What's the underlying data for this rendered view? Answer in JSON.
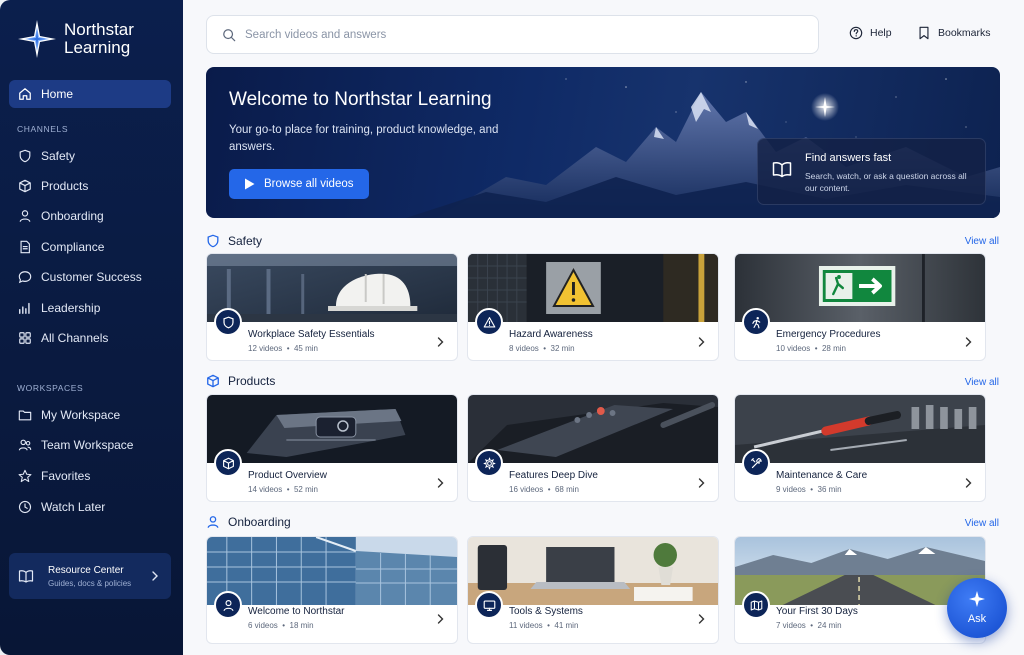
{
  "brand": {
    "line1": "Northstar",
    "line2": "Learning"
  },
  "nav": {
    "home": "Home",
    "channels_label": "CHANNELS",
    "channels": [
      "Safety",
      "Products",
      "Onboarding",
      "Compliance",
      "Customer Success",
      "Leadership",
      "All Channels"
    ],
    "workspaces_label": "WORKSPACES",
    "workspaces": [
      "My Workspace",
      "Team Workspace",
      "Favorites",
      "Watch Later"
    ]
  },
  "resource": {
    "title": "Resource Center",
    "subtitle": "Guides, docs & policies"
  },
  "search": {
    "placeholder": "Search videos and answers"
  },
  "toplinks": {
    "help": "Help",
    "bookmarks": "Bookmarks"
  },
  "hero": {
    "title": "Welcome to Northstar Learning",
    "subtitle": "Your go-to place for training, product knowledge, and answers.",
    "button": "Browse all videos",
    "find_title": "Find answers fast",
    "find_sub": "Search, watch, or ask a question across all our content."
  },
  "sections": [
    {
      "title": "Safety",
      "view_all": "View all",
      "cards": [
        {
          "title": "Workplace Safety Essentials",
          "videos": "12 videos",
          "duration": "45 min",
          "icon": "shield-icon"
        },
        {
          "title": "Hazard Awareness",
          "videos": "8 videos",
          "duration": "32 min",
          "icon": "warning-icon"
        },
        {
          "title": "Emergency Procedures",
          "videos": "10 videos",
          "duration": "28 min",
          "icon": "running-person-icon"
        }
      ]
    },
    {
      "title": "Products",
      "view_all": "View all",
      "cards": [
        {
          "title": "Product Overview",
          "videos": "14 videos",
          "duration": "52 min",
          "icon": "cube-icon"
        },
        {
          "title": "Features Deep Dive",
          "videos": "16 videos",
          "duration": "68 min",
          "icon": "gear-icon"
        },
        {
          "title": "Maintenance & Care",
          "videos": "9 videos",
          "duration": "36 min",
          "icon": "tools-icon"
        }
      ]
    },
    {
      "title": "Onboarding",
      "view_all": "View all",
      "cards": [
        {
          "title": "Welcome to Northstar",
          "videos": "6 videos",
          "duration": "18 min",
          "icon": "user-icon"
        },
        {
          "title": "Tools & Systems",
          "videos": "11 videos",
          "duration": "41 min",
          "icon": "monitor-icon"
        },
        {
          "title": "Your First 30 Days",
          "videos": "7 videos",
          "duration": "24 min",
          "icon": "map-icon"
        }
      ]
    }
  ],
  "ask": {
    "label": "Ask"
  },
  "colors": {
    "sidebar": "#0b1f4d",
    "accent": "#2467e8",
    "active_nav": "#1d3b85"
  },
  "meta_separator": "•"
}
